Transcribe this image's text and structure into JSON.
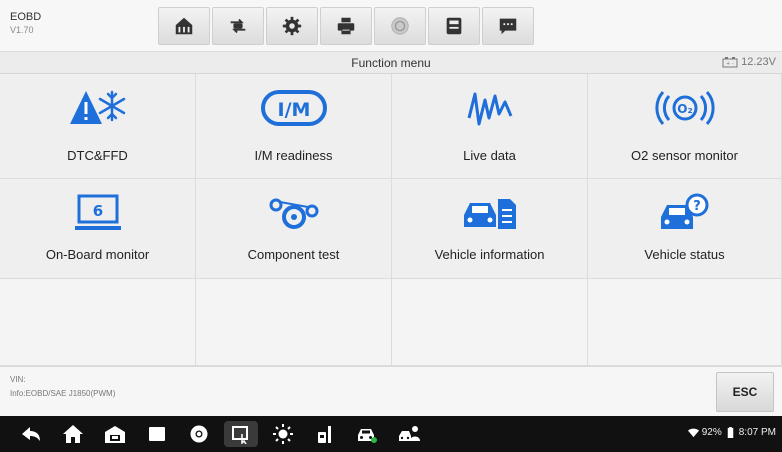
{
  "app": {
    "name": "EOBD",
    "version": "V1.70"
  },
  "toolbar": {
    "buttons": [
      {
        "icon": "home-icon"
      },
      {
        "icon": "vehicle-swap-icon"
      },
      {
        "icon": "settings-icon"
      },
      {
        "icon": "print-icon"
      },
      {
        "icon": "help-icon"
      },
      {
        "icon": "save-icon"
      },
      {
        "icon": "data-logging-icon"
      }
    ]
  },
  "header": {
    "title": "Function menu",
    "battery_voltage": "12.23V"
  },
  "menu": {
    "items": [
      {
        "label": "DTC&FFD",
        "icon": "dtc-warning-icon"
      },
      {
        "label": "I/M readiness",
        "icon": "im-readiness-icon"
      },
      {
        "label": "Live data",
        "icon": "live-data-icon"
      },
      {
        "label": "O2 sensor monitor",
        "icon": "o2-sensor-icon"
      },
      {
        "label": "On-Board monitor",
        "icon": "onboard-monitor-icon"
      },
      {
        "label": "Component test",
        "icon": "component-test-icon"
      },
      {
        "label": "Vehicle information",
        "icon": "vehicle-info-icon"
      },
      {
        "label": "Vehicle status",
        "icon": "vehicle-status-icon"
      }
    ]
  },
  "footer": {
    "vin_label": "VIN:",
    "info": "Info:EOBD/SAE J1850(PWM)",
    "esc_label": "ESC"
  },
  "system_bar": {
    "battery": "92%",
    "time": "8:07 PM"
  },
  "colors": {
    "accent": "#1e6fd9",
    "warning": "#e04040"
  }
}
